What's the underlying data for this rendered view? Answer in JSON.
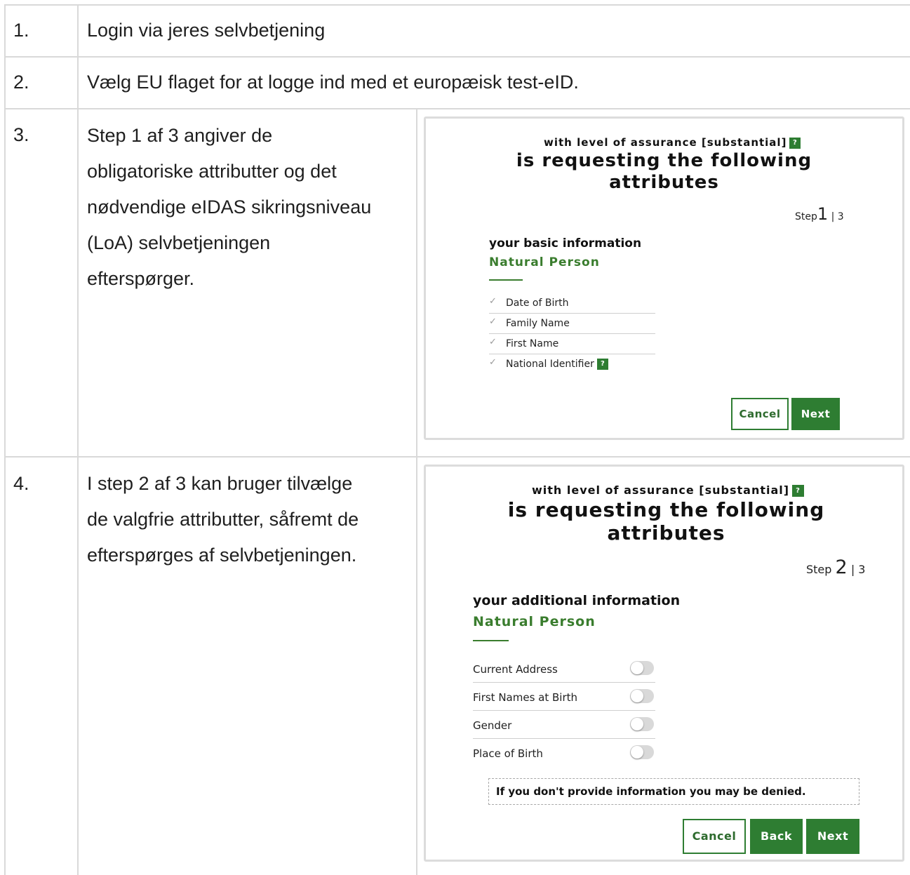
{
  "rows": [
    {
      "num": "1.",
      "text": "Login via jeres selvbetjening"
    },
    {
      "num": "2.",
      "text": "Vælg EU flaget for at logge ind med et europæisk test-eID."
    },
    {
      "num": "3.",
      "lines": [
        "Step 1 af 3 angiver de",
        "obligatoriske attributter og det",
        "nødvendige eIDAS sikringsniveau",
        "(LoA) selvbetjeningen",
        "efterspørger."
      ]
    },
    {
      "num": "4.",
      "lines": [
        "I step 2 af 3 kan bruger tilvælge",
        "de valgfrie attributter, såfremt de",
        "efterspørges af selvbetjeningen."
      ]
    }
  ],
  "panel1": {
    "loa": "with level of assurance [substantial]",
    "help": "?",
    "heading_line1": "is requesting the following",
    "heading_line2": "attributes",
    "step_label": "Step",
    "step_num": "1",
    "step_total": "| 3",
    "section_title": "your basic information",
    "section_subtitle": "Natural Person",
    "attributes": [
      "Date of Birth",
      "Family Name",
      "First Name",
      "National Identifier"
    ],
    "check": "✓",
    "cancel": "Cancel",
    "next": "Next"
  },
  "panel2": {
    "loa": "with level of assurance [substantial]",
    "help": "?",
    "heading_line1": "is requesting the following",
    "heading_line2": "attributes",
    "step_label": "Step",
    "step_num": "2",
    "step_total": "| 3",
    "section_title": "your additional information",
    "section_subtitle": "Natural Person",
    "attributes": [
      "Current Address",
      "First Names at Birth",
      "Gender",
      "Place of Birth"
    ],
    "toggle_states": [
      false,
      false,
      false,
      false
    ],
    "notice": "If you don't provide information you may be denied.",
    "cancel": "Cancel",
    "back": "Back",
    "next": "Next"
  },
  "colors": {
    "accent": "#2e7d32",
    "grid": "#d9d9d9"
  }
}
